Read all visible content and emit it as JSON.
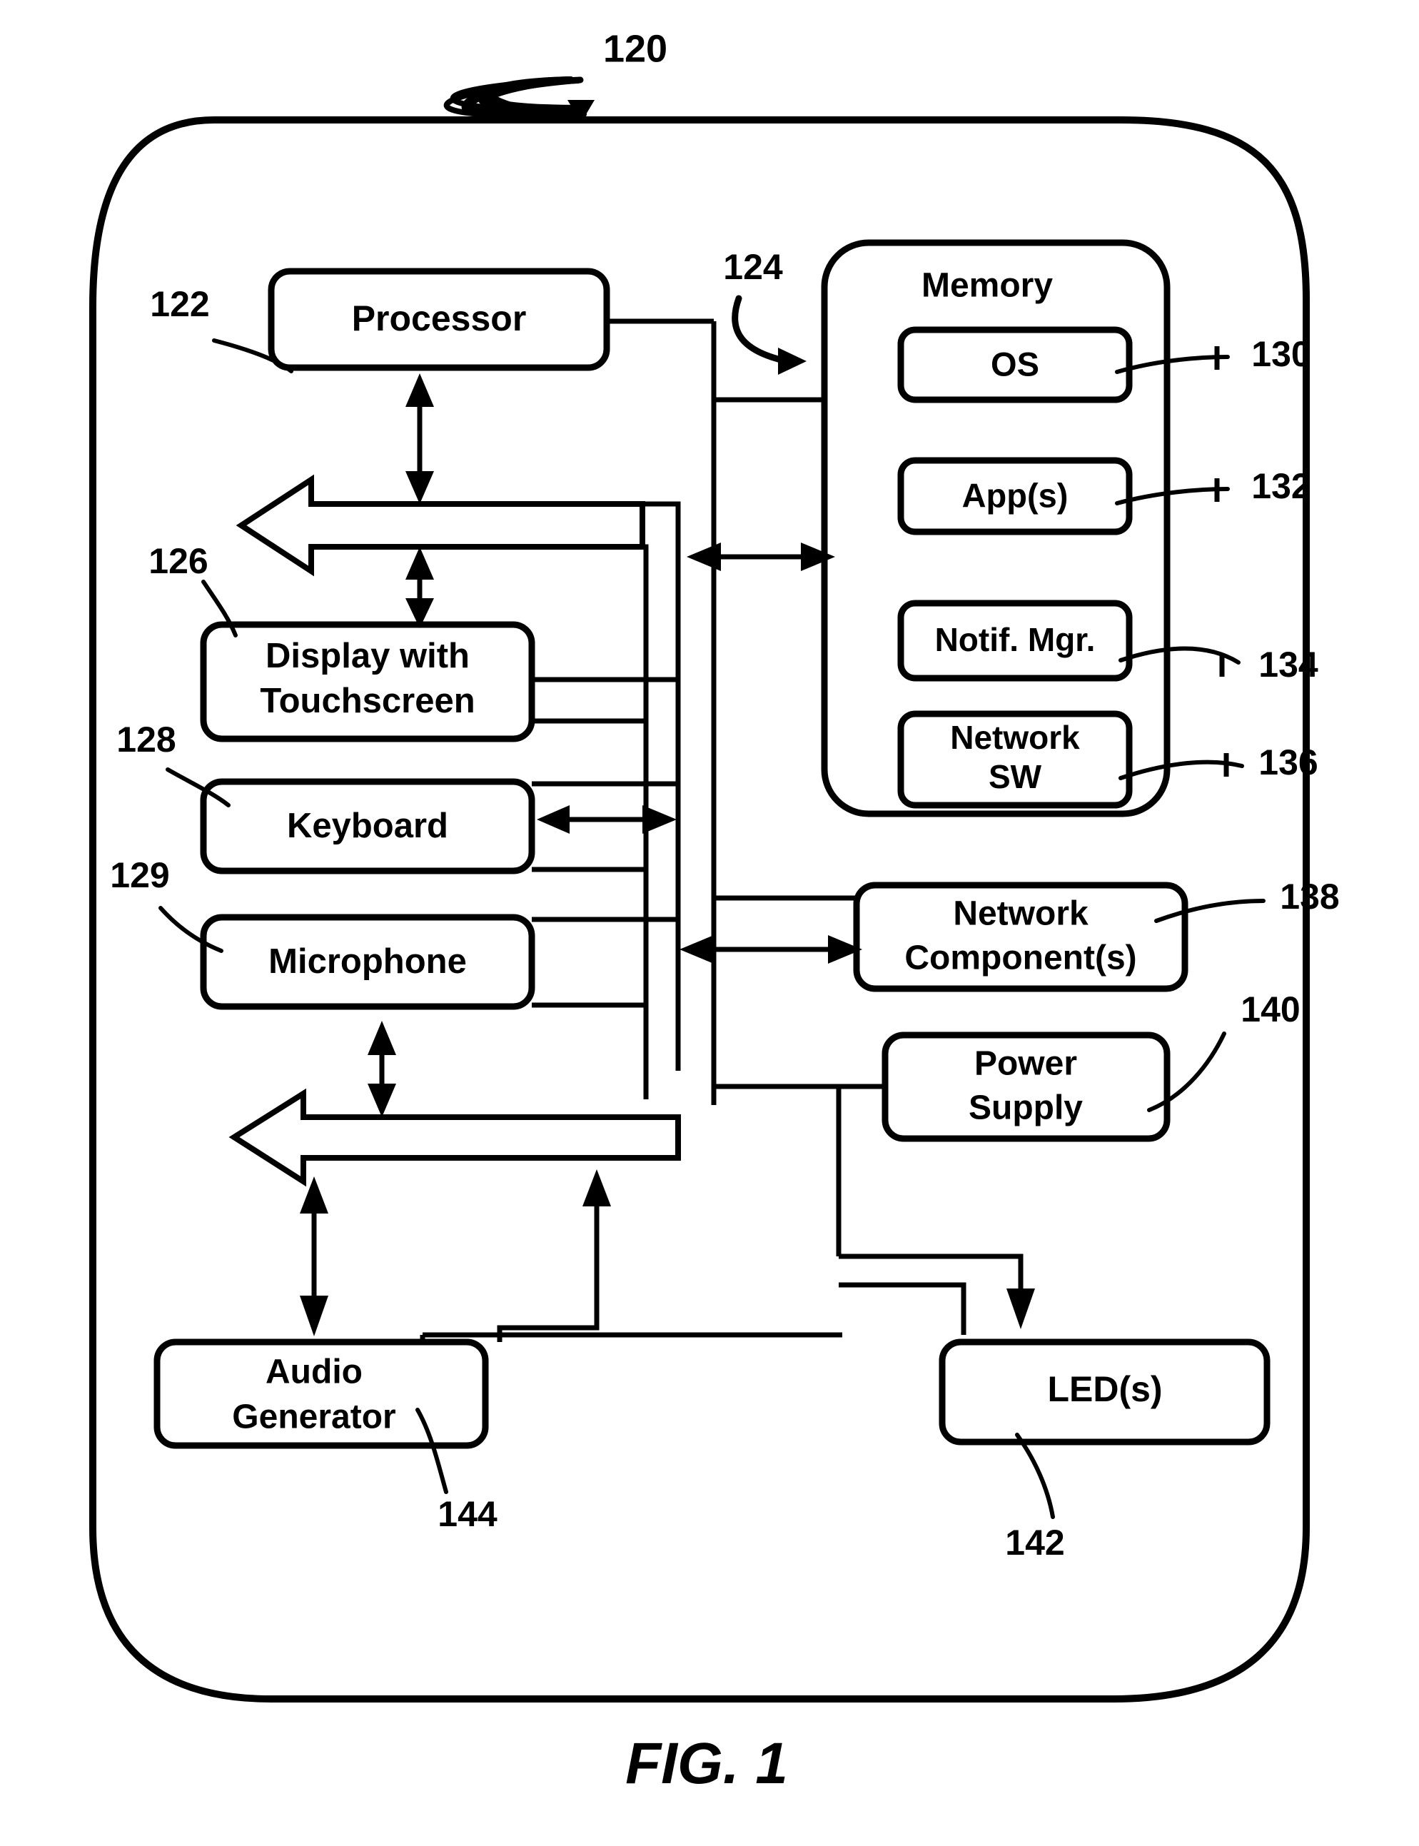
{
  "figure": {
    "caption": "FIG. 1",
    "device_ref": "120"
  },
  "blocks": [
    {
      "id": "processor",
      "label": "Processor",
      "ref": "122"
    },
    {
      "id": "bus",
      "label": "",
      "ref": "124"
    },
    {
      "id": "memory",
      "label": "Memory",
      "ref": ""
    },
    {
      "id": "os",
      "label": "OS",
      "ref": "130"
    },
    {
      "id": "apps",
      "label": "App(s)",
      "ref": "132"
    },
    {
      "id": "notif-mgr",
      "label": "Notif. Mgr.",
      "ref": "134"
    },
    {
      "id": "network-sw",
      "label": "Network\nSW",
      "ref": "136"
    },
    {
      "id": "display",
      "label": "Display with\nTouchscreen",
      "ref": "126"
    },
    {
      "id": "keyboard",
      "label": "Keyboard",
      "ref": "128"
    },
    {
      "id": "microphone",
      "label": "Microphone",
      "ref": "129"
    },
    {
      "id": "network-comp",
      "label": "Network\nComponent(s)",
      "ref": "138"
    },
    {
      "id": "power-supply",
      "label": "Power\nSupply",
      "ref": "140"
    },
    {
      "id": "leds",
      "label": "LED(s)",
      "ref": "142"
    },
    {
      "id": "audio-gen",
      "label": "Audio\nGenerator",
      "ref": "144"
    }
  ],
  "labels": {
    "processor": "Processor",
    "memory": "Memory",
    "os": "OS",
    "apps": "App(s)",
    "notif_mgr": "Notif. Mgr.",
    "network_sw_line1": "Network",
    "network_sw_line2": "SW",
    "display_line1": "Display with",
    "display_line2": "Touchscreen",
    "keyboard": "Keyboard",
    "microphone": "Microphone",
    "network_comp_line1": "Network",
    "network_comp_line2": "Component(s)",
    "power_line1": "Power",
    "power_line2": "Supply",
    "leds": "LED(s)",
    "audio_line1": "Audio",
    "audio_line2": "Generator"
  },
  "refs": {
    "device": "120",
    "processor": "122",
    "bus": "124",
    "display": "126",
    "keyboard": "128",
    "microphone": "129",
    "os": "130",
    "apps": "132",
    "notif_mgr": "134",
    "network_sw": "136",
    "network_comp": "138",
    "power_supply": "140",
    "leds": "142",
    "audio_gen": "144"
  },
  "colors": {
    "line": "#000000",
    "fill": "#ffffff"
  }
}
